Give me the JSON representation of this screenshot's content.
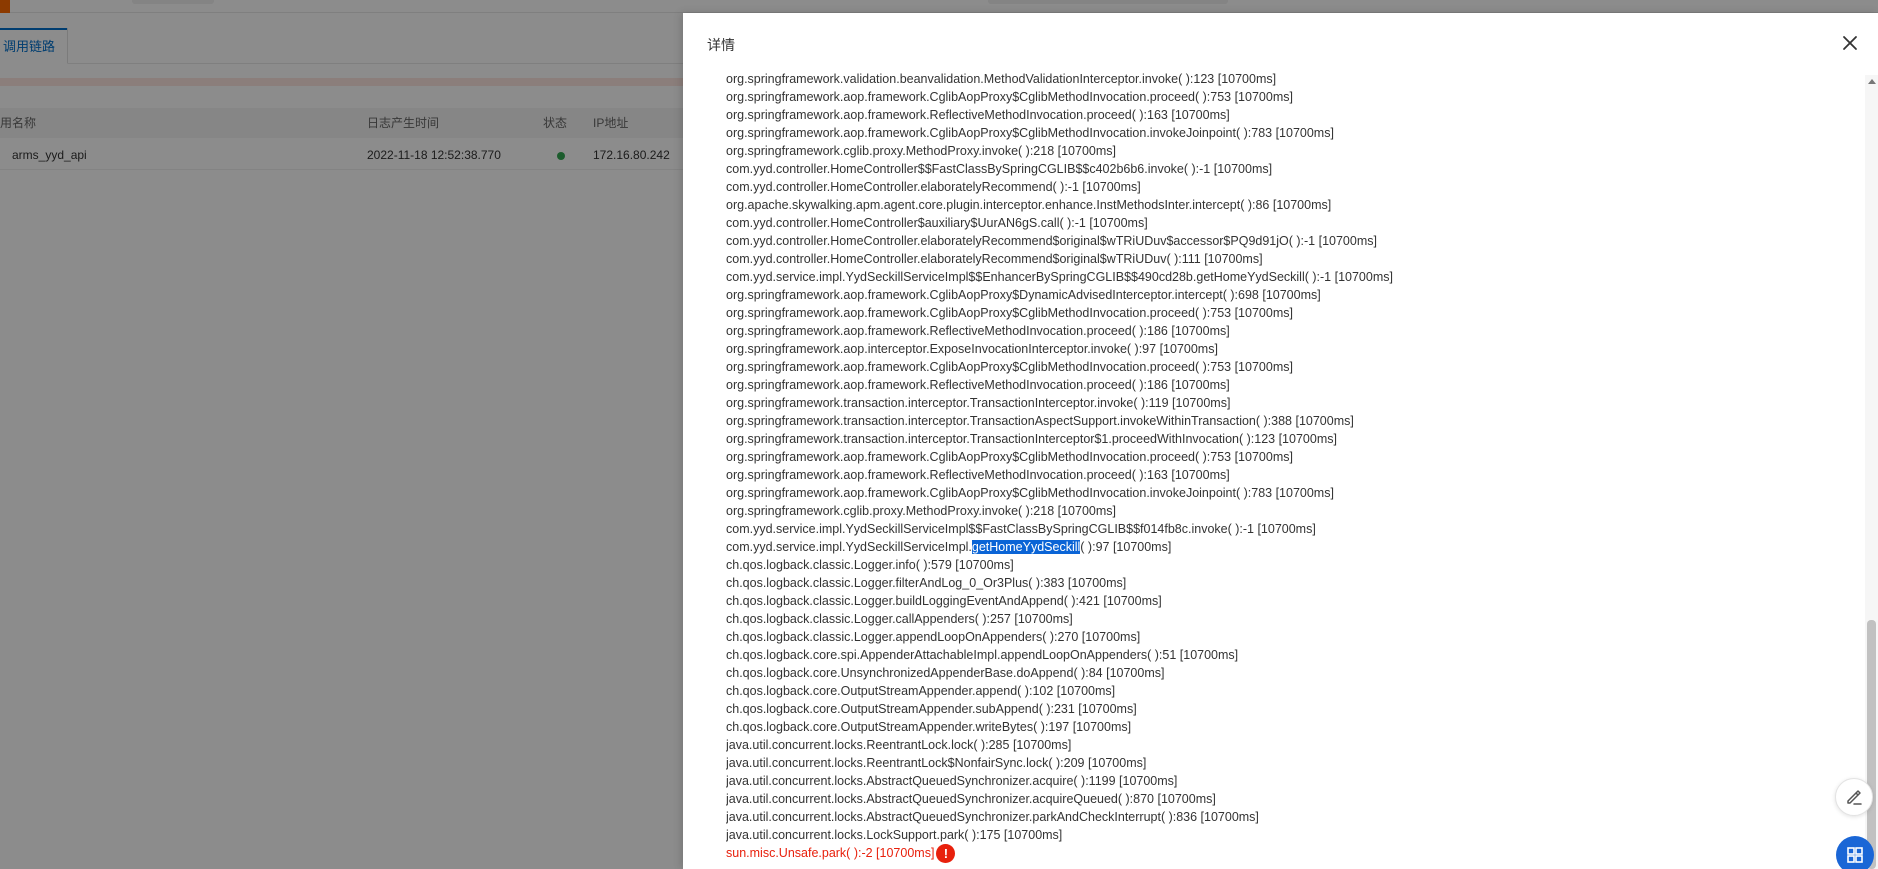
{
  "background": {
    "tab_label": "调用链路",
    "table": {
      "headers": [
        "用名称",
        "日志产生时间",
        "状态",
        "IP地址"
      ],
      "row": {
        "name": "arms_yyd_api",
        "time": "2022-11-18 12:52:38.770",
        "status": "ok",
        "ip": "172.16.80.242"
      }
    }
  },
  "drawer": {
    "title": "详情",
    "close_icon": "close-icon",
    "trace_lines": [
      "org.springframework.validation.beanvalidation.MethodValidationInterceptor.invoke( ):123 [10700ms]",
      "org.springframework.aop.framework.CglibAopProxy$CglibMethodInvocation.proceed( ):753 [10700ms]",
      "org.springframework.aop.framework.ReflectiveMethodInvocation.proceed( ):163 [10700ms]",
      "org.springframework.aop.framework.CglibAopProxy$CglibMethodInvocation.invokeJoinpoint( ):783 [10700ms]",
      "org.springframework.cglib.proxy.MethodProxy.invoke( ):218 [10700ms]",
      "com.yyd.controller.HomeController$$FastClassBySpringCGLIB$$c402b6b6.invoke( ):-1 [10700ms]",
      "com.yyd.controller.HomeController.elaboratelyRecommend( ):-1 [10700ms]",
      "org.apache.skywalking.apm.agent.core.plugin.interceptor.enhance.InstMethodsInter.intercept( ):86 [10700ms]",
      "com.yyd.controller.HomeController$auxiliary$UurAN6gS.call( ):-1 [10700ms]",
      "com.yyd.controller.HomeController.elaboratelyRecommend$original$wTRiUDuv$accessor$PQ9d91jO( ):-1 [10700ms]",
      "com.yyd.controller.HomeController.elaboratelyRecommend$original$wTRiUDuv( ):111 [10700ms]",
      "com.yyd.service.impl.YydSeckillServiceImpl$$EnhancerBySpringCGLIB$$490cd28b.getHomeYydSeckill( ):-1 [10700ms]",
      "org.springframework.aop.framework.CglibAopProxy$DynamicAdvisedInterceptor.intercept( ):698 [10700ms]",
      "org.springframework.aop.framework.CglibAopProxy$CglibMethodInvocation.proceed( ):753 [10700ms]",
      "org.springframework.aop.framework.ReflectiveMethodInvocation.proceed( ):186 [10700ms]",
      "org.springframework.aop.interceptor.ExposeInvocationInterceptor.invoke( ):97 [10700ms]",
      "org.springframework.aop.framework.CglibAopProxy$CglibMethodInvocation.proceed( ):753 [10700ms]",
      "org.springframework.aop.framework.ReflectiveMethodInvocation.proceed( ):186 [10700ms]",
      "org.springframework.transaction.interceptor.TransactionInterceptor.invoke( ):119 [10700ms]",
      "org.springframework.transaction.interceptor.TransactionAspectSupport.invokeWithinTransaction( ):388 [10700ms]",
      "org.springframework.transaction.interceptor.TransactionInterceptor$1.proceedWithInvocation( ):123 [10700ms]",
      "org.springframework.aop.framework.CglibAopProxy$CglibMethodInvocation.proceed( ):753 [10700ms]",
      "org.springframework.aop.framework.ReflectiveMethodInvocation.proceed( ):163 [10700ms]",
      "org.springframework.aop.framework.CglibAopProxy$CglibMethodInvocation.invokeJoinpoint( ):783 [10700ms]",
      "org.springframework.cglib.proxy.MethodProxy.invoke( ):218 [10700ms]",
      "com.yyd.service.impl.YydSeckillServiceImpl$$FastClassBySpringCGLIB$$f014fb8c.invoke( ):-1 [10700ms]"
    ],
    "highlight_line": {
      "prefix": "com.yyd.service.impl.YydSeckillServiceImpl.",
      "selected": "getHomeYydSeckill",
      "suffix": "( ):97 [10700ms]"
    },
    "trace_lines_after": [
      "ch.qos.logback.classic.Logger.info( ):579 [10700ms]",
      "ch.qos.logback.classic.Logger.filterAndLog_0_Or3Plus( ):383 [10700ms]",
      "ch.qos.logback.classic.Logger.buildLoggingEventAndAppend( ):421 [10700ms]",
      "ch.qos.logback.classic.Logger.callAppenders( ):257 [10700ms]",
      "ch.qos.logback.classic.Logger.appendLoopOnAppenders( ):270 [10700ms]",
      "ch.qos.logback.core.spi.AppenderAttachableImpl.appendLoopOnAppenders( ):51 [10700ms]",
      "ch.qos.logback.core.UnsynchronizedAppenderBase.doAppend( ):84 [10700ms]",
      "ch.qos.logback.core.OutputStreamAppender.append( ):102 [10700ms]",
      "ch.qos.logback.core.OutputStreamAppender.subAppend( ):231 [10700ms]",
      "ch.qos.logback.core.OutputStreamAppender.writeBytes( ):197 [10700ms]",
      "java.util.concurrent.locks.ReentrantLock.lock( ):285 [10700ms]",
      "java.util.concurrent.locks.ReentrantLock$NonfairSync.lock( ):209 [10700ms]",
      "java.util.concurrent.locks.AbstractQueuedSynchronizer.acquire( ):1199 [10700ms]",
      "java.util.concurrent.locks.AbstractQueuedSynchronizer.acquireQueued( ):870 [10700ms]",
      "java.util.concurrent.locks.AbstractQueuedSynchronizer.parkAndCheckInterrupt( ):836 [10700ms]",
      "java.util.concurrent.locks.LockSupport.park( ):175 [10700ms]"
    ],
    "error_line": "sun.misc.Unsafe.park( ):-2 [10700ms]",
    "error_icon_glyph": "!"
  },
  "floating_buttons": {
    "edit_icon": "edit-icon",
    "grid_icon": "grid-icon"
  },
  "colors": {
    "accent": "#0070cc",
    "brand_orange": "#ff6a00",
    "highlight": "#0a64d6",
    "error": "#e8200c",
    "status_ok": "#34a853"
  }
}
